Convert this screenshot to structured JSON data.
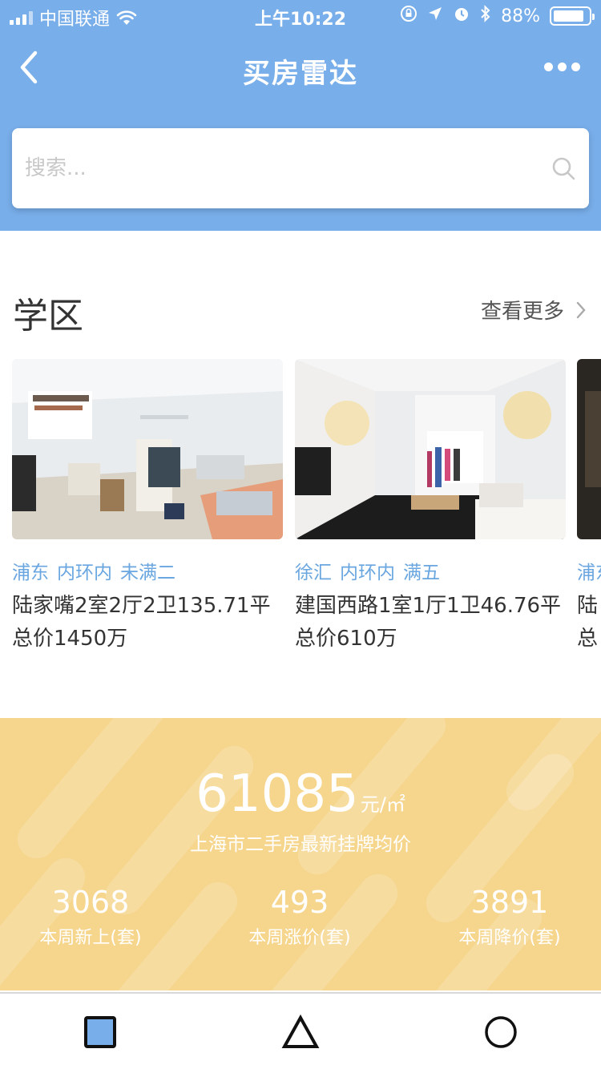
{
  "status_bar": {
    "carrier": "中国联通",
    "time": "上午10:22",
    "battery": "88%",
    "battery_level": 0.88
  },
  "nav": {
    "title": "买房雷达",
    "back_icon": "chevron-left-icon",
    "more_icon": "more-dots-icon"
  },
  "search": {
    "placeholder": "搜索...",
    "value": "",
    "icon": "search-icon"
  },
  "section": {
    "title": "学区",
    "more_label": "查看更多"
  },
  "listings": [
    {
      "tags": [
        "浦东",
        "内环内",
        "未满二"
      ],
      "name": "陆家嘴2室2厅2卫135.71平",
      "price": "总价1450万"
    },
    {
      "tags": [
        "徐汇",
        "内环内",
        "满五"
      ],
      "name": "建国西路1室1厅1卫46.76平",
      "price": "总价610万"
    },
    {
      "tags": [
        "浦东"
      ],
      "name": "陆",
      "price": "总"
    }
  ],
  "market": {
    "avg_price": "61085",
    "avg_unit": "元/㎡",
    "avg_label": "上海市二手房最新挂牌均价",
    "stats": [
      {
        "value": "3068",
        "label": "本周新上(套)"
      },
      {
        "value": "493",
        "label": "本周涨价(套)"
      },
      {
        "value": "3891",
        "label": "本周降价(套)"
      }
    ]
  },
  "tabbar": {
    "icons": [
      "square-icon",
      "triangle-icon",
      "circle-icon"
    ]
  },
  "colors": {
    "header_bg": "#78aeea",
    "tag": "#6aa6e0",
    "banner": "#f6d58c"
  }
}
